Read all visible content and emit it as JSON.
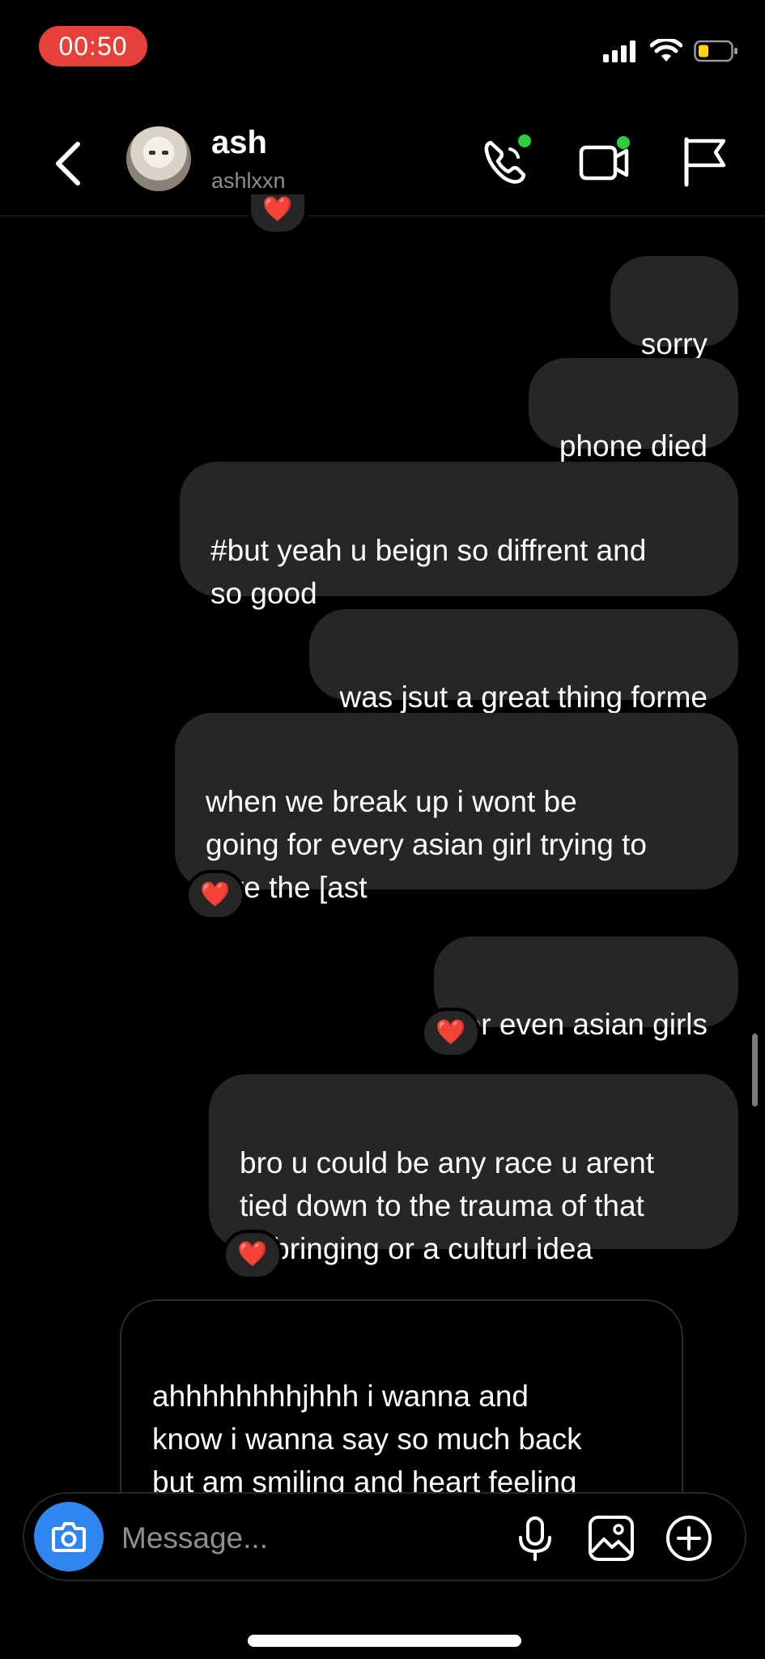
{
  "status_bar": {
    "time": "00:50",
    "time_color": "#e5403a",
    "icons": [
      "signal-icon",
      "wifi-icon",
      "battery-icon"
    ]
  },
  "header": {
    "contact_name": "ash",
    "contact_handle": "ashlxxn",
    "icons": [
      "back-chevron-icon",
      "phone-icon",
      "video-icon",
      "flag-icon"
    ]
  },
  "messages": [
    {
      "from": "me",
      "text": "sorry",
      "reaction": ""
    },
    {
      "from": "me",
      "text": "phone died",
      "reaction": ""
    },
    {
      "from": "me",
      "text": "#but yeah u beign so diffrent and\nso good",
      "reaction": ""
    },
    {
      "from": "me",
      "text": "was jsut a great thing forme",
      "reaction": ""
    },
    {
      "from": "me",
      "text": "when we break up i wont be\ngoing for every asian girl trying to\nrlive the [ast",
      "reaction": "❤️"
    },
    {
      "from": "me",
      "text": "or even asian girls",
      "reaction": "❤️"
    },
    {
      "from": "me",
      "text": "bro u could be any race u arent\ntied down to the trauma of that\nupbringing or a culturl idea",
      "reaction": "❤️"
    },
    {
      "from": "them",
      "text": "ahhhhhhhhjhhh i wanna and\nknow i wanna say so much back\nbut am smiling and heart feeling\nso good n so much love i cnt",
      "reaction": ""
    }
  ],
  "top_reaction": "❤️",
  "composer": {
    "placeholder": "Message..."
  },
  "colors": {
    "background": "#000000",
    "bubble": "#262626",
    "accent_blue": "#2f86ef",
    "online_green": "#2ecc40",
    "heart": "#ff2d4a"
  }
}
